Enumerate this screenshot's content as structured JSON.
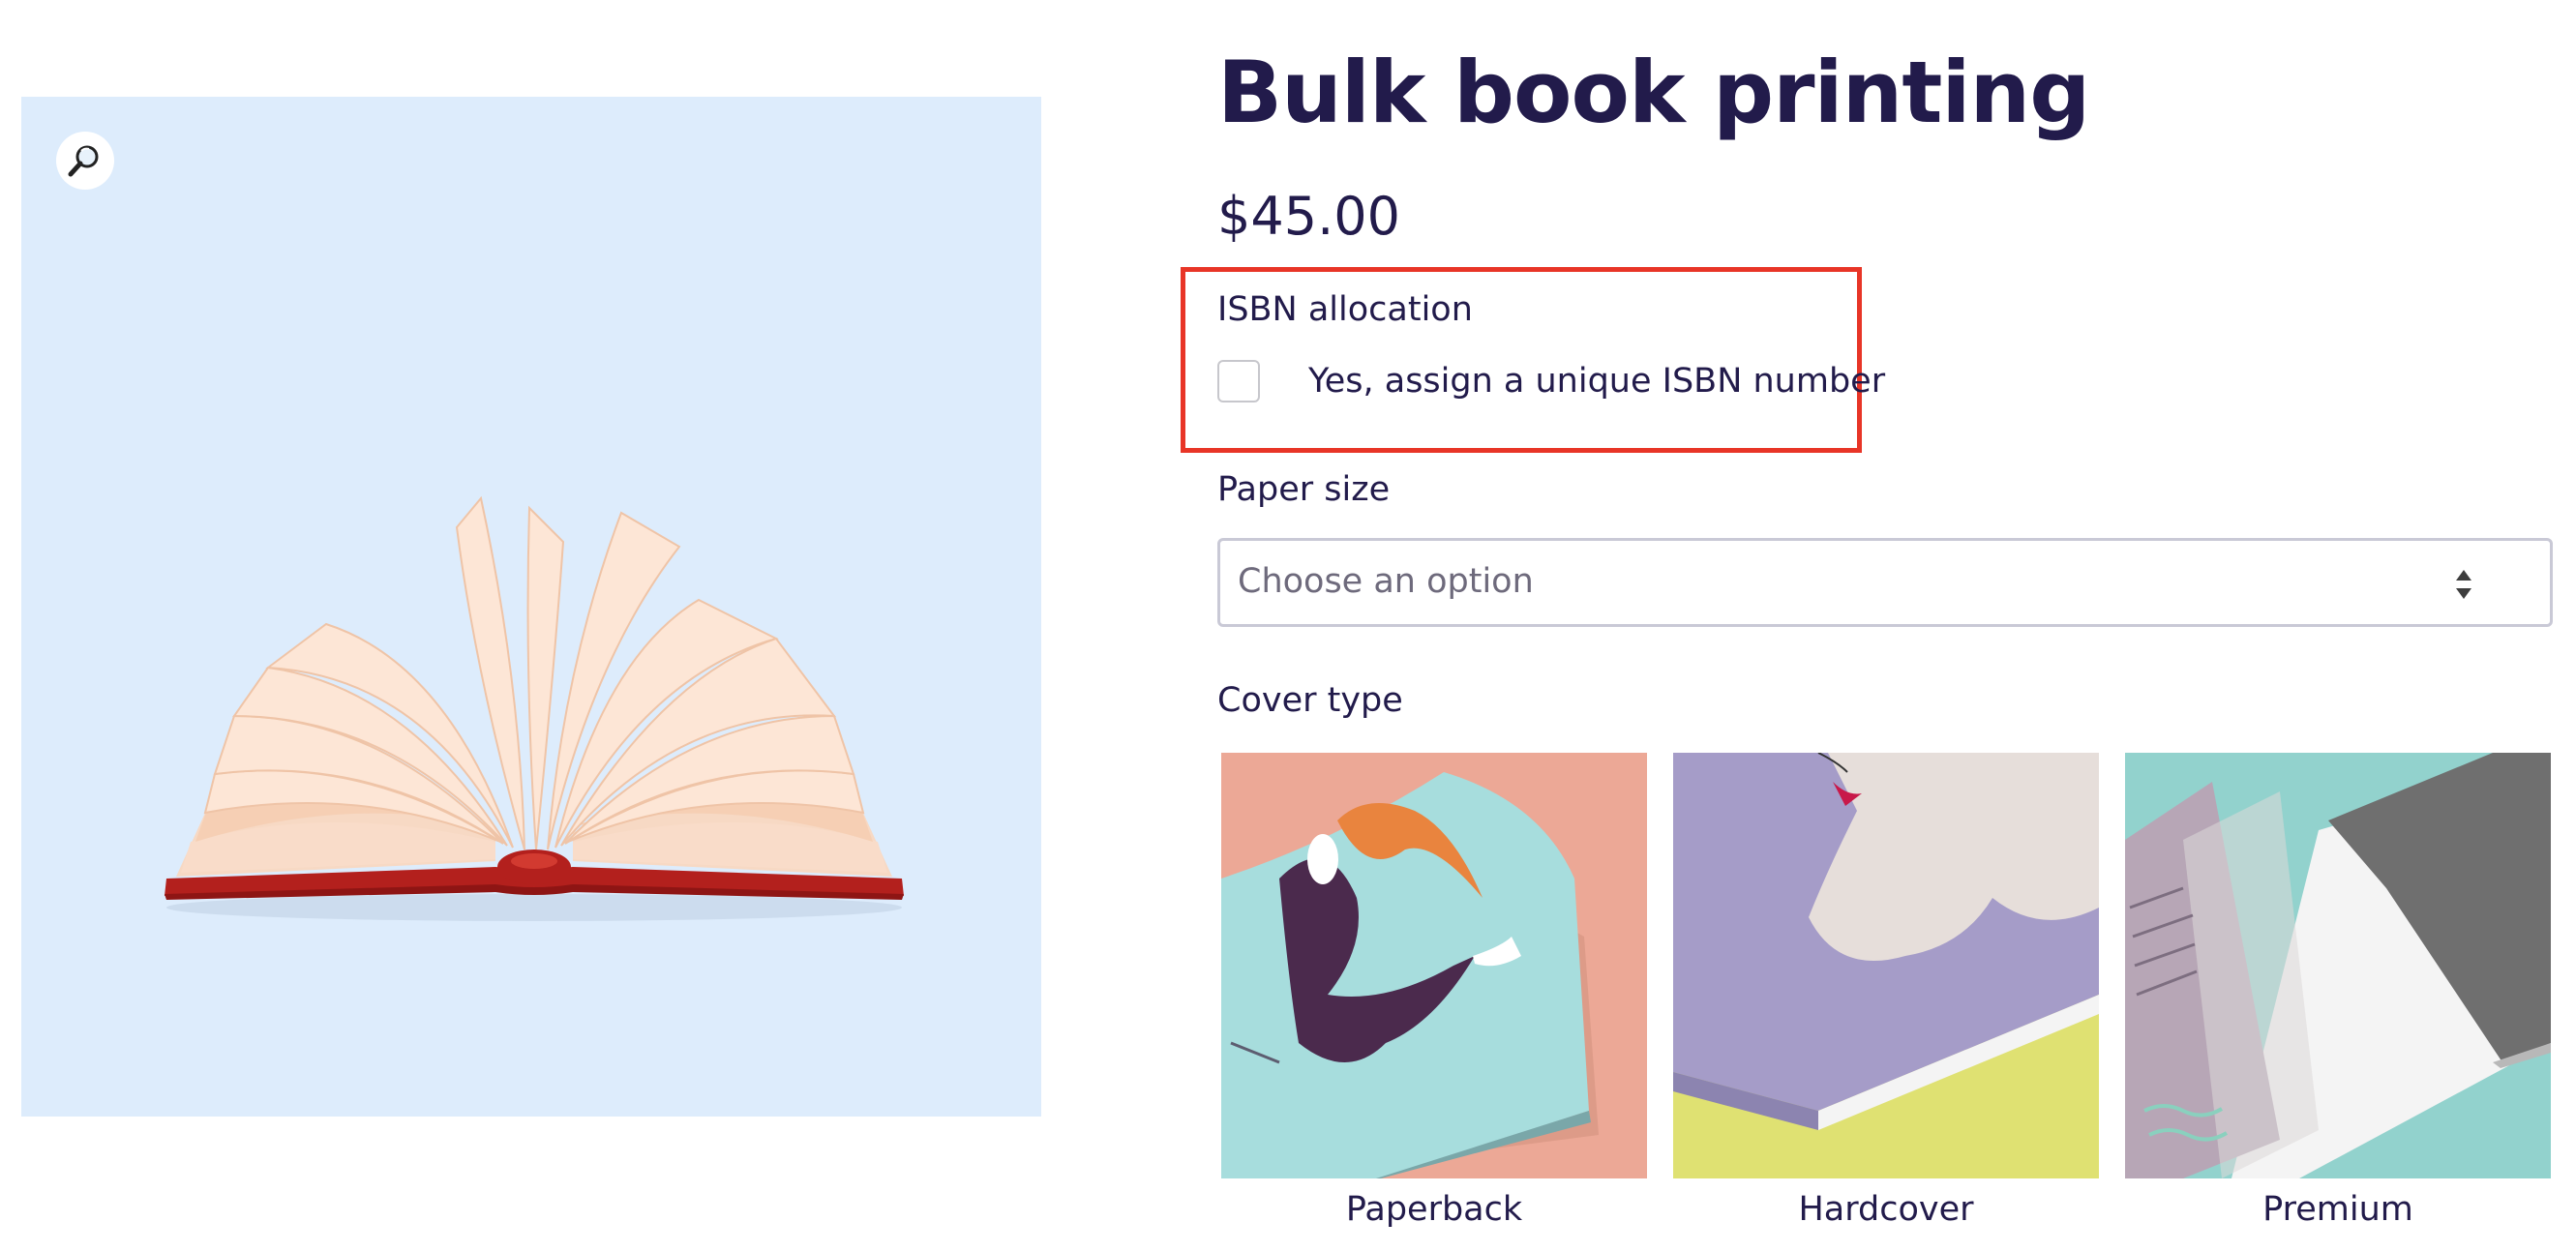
{
  "product": {
    "title": "Bulk book printing",
    "price": "$45.00"
  },
  "gallery": {
    "zoom_icon": "magnifier-icon",
    "background": "#ddecfc"
  },
  "isbn": {
    "label": "ISBN allocation",
    "option": "Yes, assign a unique ISBN number",
    "checked": false,
    "highlight_color": "#e83527"
  },
  "paper_size": {
    "label": "Paper size",
    "placeholder": "Choose an option"
  },
  "cover_type": {
    "label": "Cover type",
    "options": [
      {
        "name": "Paperback"
      },
      {
        "name": "Hardcover"
      },
      {
        "name": "Premium"
      }
    ]
  },
  "colors": {
    "text": "#221b4b",
    "book_cover": "#b3201d",
    "pages": "#fde6d6"
  }
}
